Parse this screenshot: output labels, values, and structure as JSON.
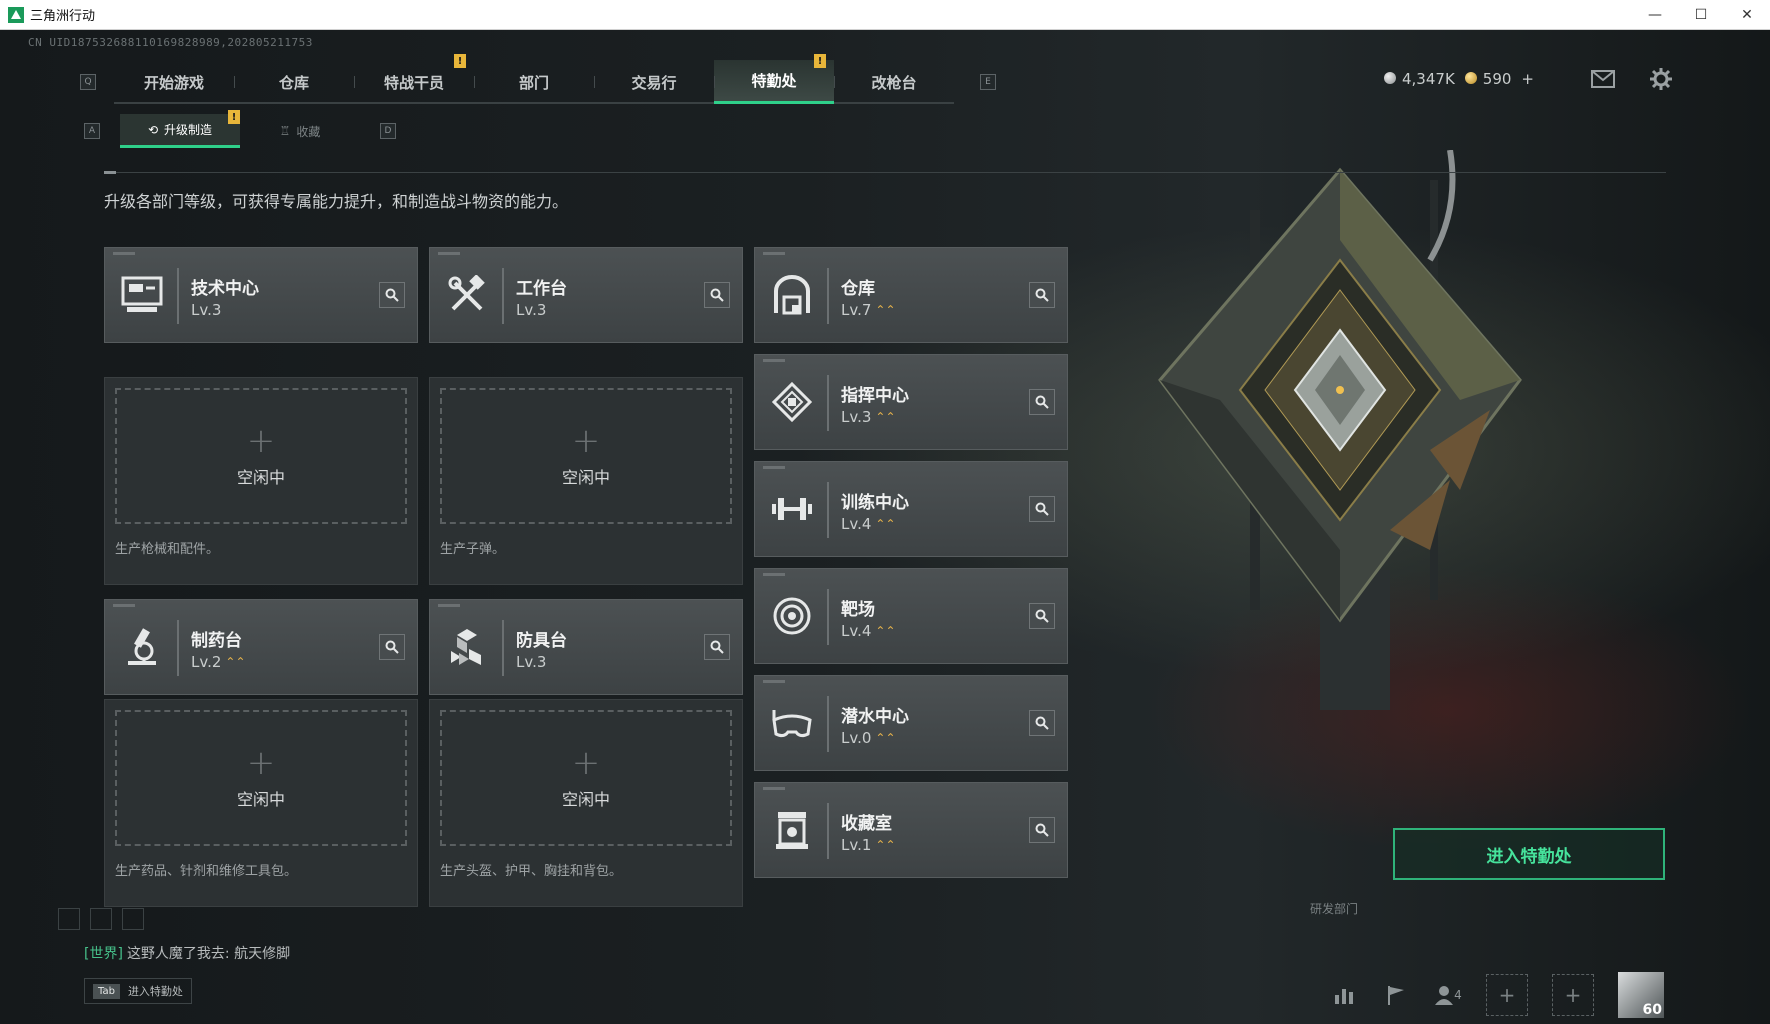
{
  "window": {
    "title": "三角洲行动",
    "minimize": "—",
    "maximize": "☐",
    "close": "✕"
  },
  "uid": "CN UID187532688110169828989,202805211753",
  "nav": {
    "left_key": "Q",
    "right_key": "E",
    "tabs": [
      {
        "label": "开始游戏"
      },
      {
        "label": "仓库"
      },
      {
        "label": "特战干员",
        "alert": "!"
      },
      {
        "label": "部门"
      },
      {
        "label": "交易行"
      },
      {
        "label": "特勤处",
        "alert": "!",
        "active": true
      },
      {
        "label": "改枪台"
      }
    ]
  },
  "currency": {
    "silver": "4,347K",
    "gold": "590",
    "gold_add": "+"
  },
  "icons": {
    "mail": "mail-icon",
    "settings": "gear-icon"
  },
  "subnav": {
    "left_key": "A",
    "right_key": "D",
    "tabs": [
      {
        "label": "升级制造",
        "alert": "!",
        "active": true,
        "icon": "upgrade-icon"
      },
      {
        "label": "收藏",
        "icon": "trophy-icon"
      }
    ]
  },
  "description": "升级各部门等级，可获得专属能力提升，和制造战斗物资的能力。",
  "production_departments": [
    {
      "name": "技术中心",
      "level": "Lv.3",
      "upgradable": false,
      "icon": "computer-icon",
      "idle": "空闲中",
      "plus": "+",
      "produce": "生产枪械和配件。"
    },
    {
      "name": "工作台",
      "level": "Lv.3",
      "upgradable": false,
      "icon": "tools-icon",
      "idle": "空闲中",
      "plus": "+",
      "produce": "生产子弹。"
    },
    {
      "name": "制药台",
      "level": "Lv.2",
      "upgradable": true,
      "icon": "microscope-icon",
      "idle": "空闲中",
      "plus": "+",
      "produce": "生产药品、针剂和维修工具包。"
    },
    {
      "name": "防具台",
      "level": "Lv.3",
      "upgradable": false,
      "icon": "armor-blocks-icon",
      "idle": "空闲中",
      "plus": "+",
      "produce": "生产头盔、护甲、胸挂和背包。"
    }
  ],
  "other_departments": [
    {
      "name": "仓库",
      "level": "Lv.7",
      "upgradable": true,
      "icon": "warehouse-icon"
    },
    {
      "name": "指挥中心",
      "level": "Lv.3",
      "upgradable": true,
      "icon": "command-icon"
    },
    {
      "name": "训练中心",
      "level": "Lv.4",
      "upgradable": true,
      "icon": "dumbbell-icon"
    },
    {
      "name": "靶场",
      "level": "Lv.4",
      "upgradable": true,
      "icon": "target-icon"
    },
    {
      "name": "潜水中心",
      "level": "Lv.0",
      "upgradable": true,
      "icon": "diving-mask-icon"
    },
    {
      "name": "收藏室",
      "level": "Lv.1",
      "upgradable": true,
      "icon": "collection-icon"
    }
  ],
  "enter_button": "进入特勤处",
  "building_label": "研发部门",
  "chat": {
    "channel": "[世界]",
    "message": "这野人魔了我去: 航天修脚"
  },
  "tab_hint": {
    "key": "Tab",
    "label": "进入特勤处"
  },
  "bottom": {
    "friends_count": "4",
    "player_level": "60"
  },
  "colors": {
    "accent": "#2fd08a",
    "alert": "#e8b63a",
    "upgrade": "#e3b04a"
  }
}
